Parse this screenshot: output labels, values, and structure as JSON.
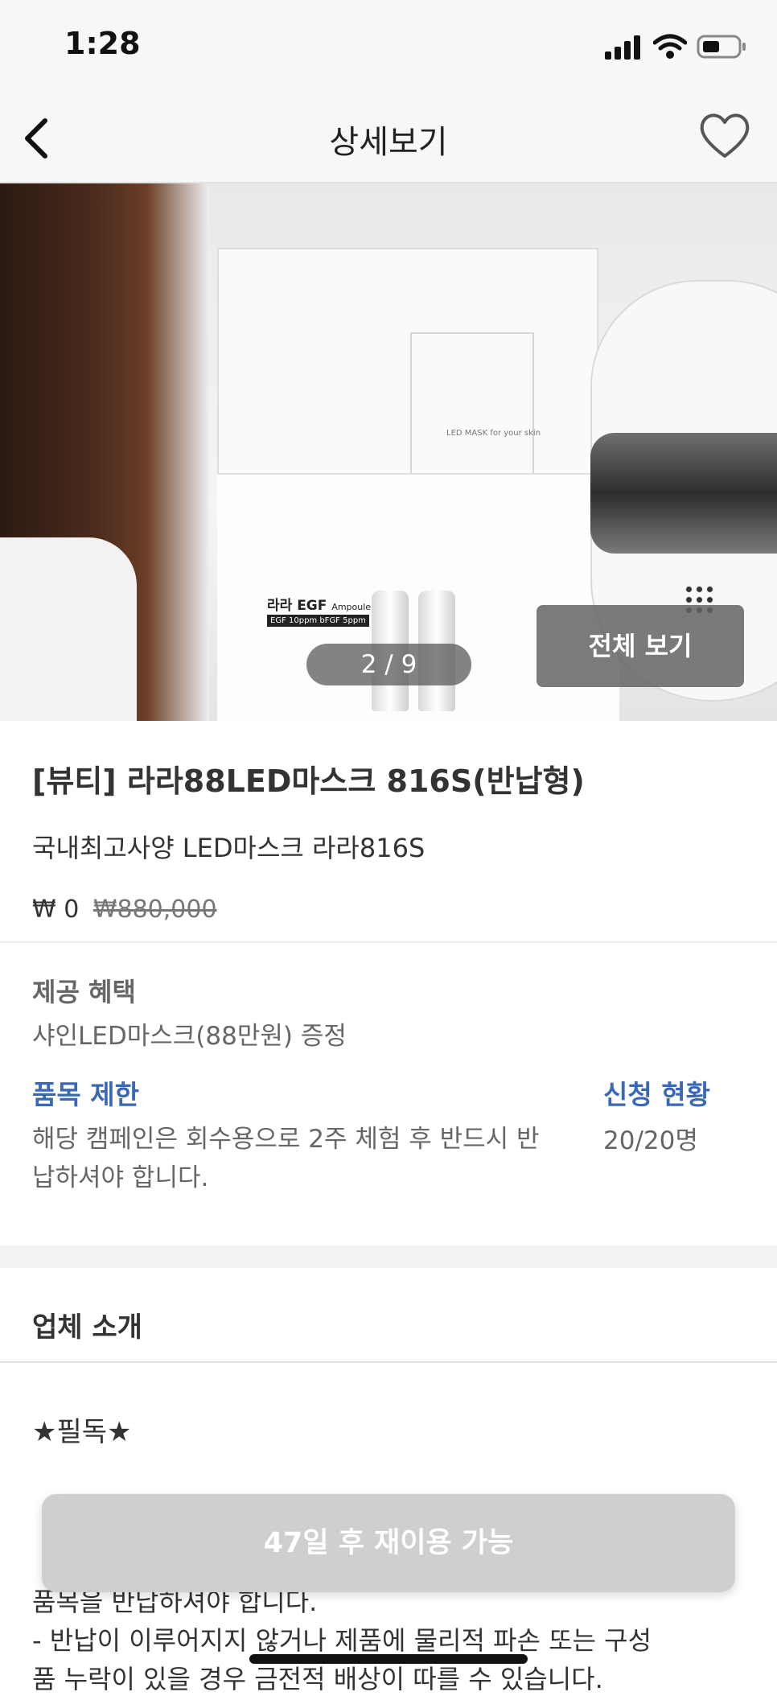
{
  "status_bar": {
    "time": "1:28",
    "icons": [
      "signal-icon",
      "wifi-icon",
      "battery-icon"
    ]
  },
  "nav": {
    "title": "상세보기",
    "back_icon": "chevron-left-icon",
    "favorite_icon": "heart-outline-icon"
  },
  "gallery": {
    "page_indicator": "2 / 9",
    "current_page": 2,
    "total_pages": 9,
    "view_all_label": "전체 보기",
    "box_text": "라라 EGF",
    "box_small_text": "Ampoule",
    "box_tag": "EGF 10ppm  bFGF 5ppm",
    "box_inner_text": "LED MASK for your skin"
  },
  "product": {
    "title": "[뷰티] 라라88LED마스크 816S(반납형)",
    "subtitle": "국내최고사양 LED마스크 라라816S",
    "price": "₩ 0",
    "original_price": "₩880,000"
  },
  "benefit": {
    "label": "제공 혜택",
    "value": "샤인LED마스크(88만원) 증정"
  },
  "restriction": {
    "label": "품목 제한",
    "value": "해당 캠페인은 회수용으로 2주 체험 후 반드시 반납하셔야 합니다."
  },
  "application": {
    "label": "신청 현황",
    "value": "20/20명"
  },
  "company": {
    "heading": "업체 소개",
    "must_read": "★필독★",
    "lines": [
      "품목을 반납하셔야 합니다.",
      " - 반납이 이루어지지 않거나 제품에 물리적 파손 또는 구성",
      "품 누락이 있을 경우 금전적 배상이 따를 수 있습니다."
    ]
  },
  "bottom_bar": {
    "label": "47일 후 재이용 가능"
  },
  "colors": {
    "accent": "#3a68b6",
    "bottom_bar_bg": "#cdcdcd"
  }
}
